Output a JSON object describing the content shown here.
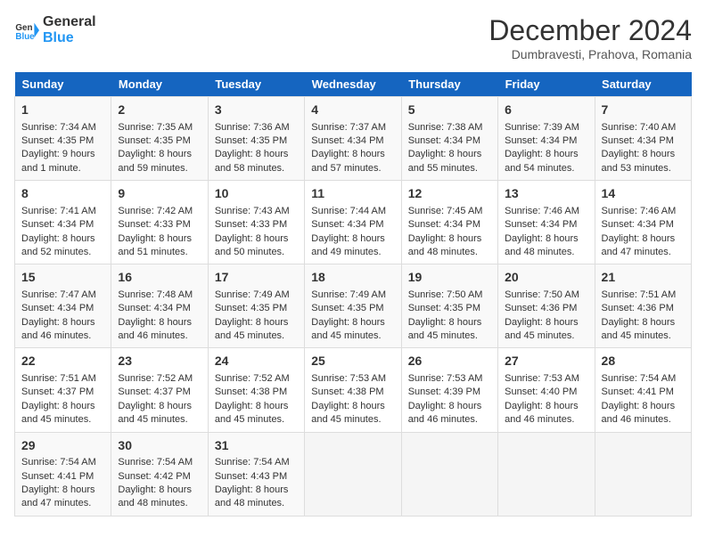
{
  "header": {
    "logo_line1": "General",
    "logo_line2": "Blue",
    "title": "December 2024",
    "subtitle": "Dumbravesti, Prahova, Romania"
  },
  "weekdays": [
    "Sunday",
    "Monday",
    "Tuesday",
    "Wednesday",
    "Thursday",
    "Friday",
    "Saturday"
  ],
  "weeks": [
    [
      {
        "day": "1",
        "lines": [
          "Sunrise: 7:34 AM",
          "Sunset: 4:35 PM",
          "Daylight: 9 hours",
          "and 1 minute."
        ]
      },
      {
        "day": "2",
        "lines": [
          "Sunrise: 7:35 AM",
          "Sunset: 4:35 PM",
          "Daylight: 8 hours",
          "and 59 minutes."
        ]
      },
      {
        "day": "3",
        "lines": [
          "Sunrise: 7:36 AM",
          "Sunset: 4:35 PM",
          "Daylight: 8 hours",
          "and 58 minutes."
        ]
      },
      {
        "day": "4",
        "lines": [
          "Sunrise: 7:37 AM",
          "Sunset: 4:34 PM",
          "Daylight: 8 hours",
          "and 57 minutes."
        ]
      },
      {
        "day": "5",
        "lines": [
          "Sunrise: 7:38 AM",
          "Sunset: 4:34 PM",
          "Daylight: 8 hours",
          "and 55 minutes."
        ]
      },
      {
        "day": "6",
        "lines": [
          "Sunrise: 7:39 AM",
          "Sunset: 4:34 PM",
          "Daylight: 8 hours",
          "and 54 minutes."
        ]
      },
      {
        "day": "7",
        "lines": [
          "Sunrise: 7:40 AM",
          "Sunset: 4:34 PM",
          "Daylight: 8 hours",
          "and 53 minutes."
        ]
      }
    ],
    [
      {
        "day": "8",
        "lines": [
          "Sunrise: 7:41 AM",
          "Sunset: 4:34 PM",
          "Daylight: 8 hours",
          "and 52 minutes."
        ]
      },
      {
        "day": "9",
        "lines": [
          "Sunrise: 7:42 AM",
          "Sunset: 4:33 PM",
          "Daylight: 8 hours",
          "and 51 minutes."
        ]
      },
      {
        "day": "10",
        "lines": [
          "Sunrise: 7:43 AM",
          "Sunset: 4:33 PM",
          "Daylight: 8 hours",
          "and 50 minutes."
        ]
      },
      {
        "day": "11",
        "lines": [
          "Sunrise: 7:44 AM",
          "Sunset: 4:34 PM",
          "Daylight: 8 hours",
          "and 49 minutes."
        ]
      },
      {
        "day": "12",
        "lines": [
          "Sunrise: 7:45 AM",
          "Sunset: 4:34 PM",
          "Daylight: 8 hours",
          "and 48 minutes."
        ]
      },
      {
        "day": "13",
        "lines": [
          "Sunrise: 7:46 AM",
          "Sunset: 4:34 PM",
          "Daylight: 8 hours",
          "and 48 minutes."
        ]
      },
      {
        "day": "14",
        "lines": [
          "Sunrise: 7:46 AM",
          "Sunset: 4:34 PM",
          "Daylight: 8 hours",
          "and 47 minutes."
        ]
      }
    ],
    [
      {
        "day": "15",
        "lines": [
          "Sunrise: 7:47 AM",
          "Sunset: 4:34 PM",
          "Daylight: 8 hours",
          "and 46 minutes."
        ]
      },
      {
        "day": "16",
        "lines": [
          "Sunrise: 7:48 AM",
          "Sunset: 4:34 PM",
          "Daylight: 8 hours",
          "and 46 minutes."
        ]
      },
      {
        "day": "17",
        "lines": [
          "Sunrise: 7:49 AM",
          "Sunset: 4:35 PM",
          "Daylight: 8 hours",
          "and 45 minutes."
        ]
      },
      {
        "day": "18",
        "lines": [
          "Sunrise: 7:49 AM",
          "Sunset: 4:35 PM",
          "Daylight: 8 hours",
          "and 45 minutes."
        ]
      },
      {
        "day": "19",
        "lines": [
          "Sunrise: 7:50 AM",
          "Sunset: 4:35 PM",
          "Daylight: 8 hours",
          "and 45 minutes."
        ]
      },
      {
        "day": "20",
        "lines": [
          "Sunrise: 7:50 AM",
          "Sunset: 4:36 PM",
          "Daylight: 8 hours",
          "and 45 minutes."
        ]
      },
      {
        "day": "21",
        "lines": [
          "Sunrise: 7:51 AM",
          "Sunset: 4:36 PM",
          "Daylight: 8 hours",
          "and 45 minutes."
        ]
      }
    ],
    [
      {
        "day": "22",
        "lines": [
          "Sunrise: 7:51 AM",
          "Sunset: 4:37 PM",
          "Daylight: 8 hours",
          "and 45 minutes."
        ]
      },
      {
        "day": "23",
        "lines": [
          "Sunrise: 7:52 AM",
          "Sunset: 4:37 PM",
          "Daylight: 8 hours",
          "and 45 minutes."
        ]
      },
      {
        "day": "24",
        "lines": [
          "Sunrise: 7:52 AM",
          "Sunset: 4:38 PM",
          "Daylight: 8 hours",
          "and 45 minutes."
        ]
      },
      {
        "day": "25",
        "lines": [
          "Sunrise: 7:53 AM",
          "Sunset: 4:38 PM",
          "Daylight: 8 hours",
          "and 45 minutes."
        ]
      },
      {
        "day": "26",
        "lines": [
          "Sunrise: 7:53 AM",
          "Sunset: 4:39 PM",
          "Daylight: 8 hours",
          "and 46 minutes."
        ]
      },
      {
        "day": "27",
        "lines": [
          "Sunrise: 7:53 AM",
          "Sunset: 4:40 PM",
          "Daylight: 8 hours",
          "and 46 minutes."
        ]
      },
      {
        "day": "28",
        "lines": [
          "Sunrise: 7:54 AM",
          "Sunset: 4:41 PM",
          "Daylight: 8 hours",
          "and 46 minutes."
        ]
      }
    ],
    [
      {
        "day": "29",
        "lines": [
          "Sunrise: 7:54 AM",
          "Sunset: 4:41 PM",
          "Daylight: 8 hours",
          "and 47 minutes."
        ]
      },
      {
        "day": "30",
        "lines": [
          "Sunrise: 7:54 AM",
          "Sunset: 4:42 PM",
          "Daylight: 8 hours",
          "and 48 minutes."
        ]
      },
      {
        "day": "31",
        "lines": [
          "Sunrise: 7:54 AM",
          "Sunset: 4:43 PM",
          "Daylight: 8 hours",
          "and 48 minutes."
        ]
      },
      null,
      null,
      null,
      null
    ]
  ]
}
